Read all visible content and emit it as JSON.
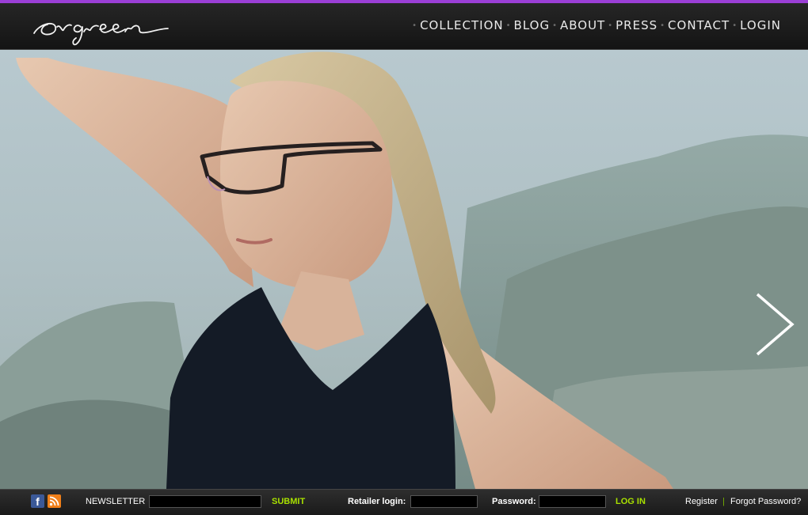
{
  "brand": {
    "logo_text": "orgreen"
  },
  "nav": {
    "items": [
      {
        "label": "COLLECTION"
      },
      {
        "label": "BLOG"
      },
      {
        "label": "ABOUT"
      },
      {
        "label": "PRESS"
      },
      {
        "label": "CONTACT"
      },
      {
        "label": "LOGIN"
      }
    ]
  },
  "hero": {
    "next_icon": "chevron-right-icon"
  },
  "footer": {
    "social": {
      "facebook_glyph": "f",
      "rss_icon": "rss-icon"
    },
    "newsletter_label": "NEWSLETTER",
    "newsletter_value": "",
    "submit_label": "SUBMIT",
    "retailer_label": "Retailer login:",
    "retailer_value": "",
    "password_label": "Password:",
    "password_value": "",
    "login_label": "LOG IN",
    "register_label": "Register",
    "divider": "|",
    "forgot_label": "Forgot Password?"
  },
  "colors": {
    "accent": "#a8e000",
    "top_bar": "#9b3fd6"
  }
}
